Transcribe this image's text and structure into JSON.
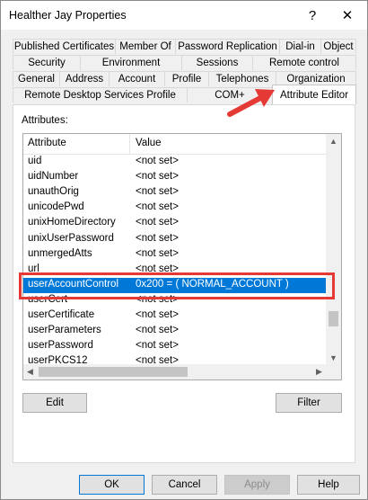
{
  "window": {
    "title": "Healther Jay Properties",
    "help_glyph": "?",
    "close_glyph": "✕"
  },
  "tabs": {
    "row1": [
      "Published Certificates",
      "Member Of",
      "Password Replication",
      "Dial-in",
      "Object"
    ],
    "row2": [
      "Security",
      "Environment",
      "Sessions",
      "Remote control"
    ],
    "row3": [
      "General",
      "Address",
      "Account",
      "Profile",
      "Telephones",
      "Organization"
    ],
    "row4": [
      "Remote Desktop Services Profile",
      "COM+",
      "Attribute Editor"
    ],
    "active": "Attribute Editor"
  },
  "attributes_label": "Attributes:",
  "list": {
    "columns": [
      "Attribute",
      "Value"
    ],
    "rows": [
      {
        "attribute": "uid",
        "value": "<not set>"
      },
      {
        "attribute": "uidNumber",
        "value": "<not set>"
      },
      {
        "attribute": "unauthOrig",
        "value": "<not set>"
      },
      {
        "attribute": "unicodePwd",
        "value": "<not set>"
      },
      {
        "attribute": "unixHomeDirectory",
        "value": "<not set>"
      },
      {
        "attribute": "unixUserPassword",
        "value": "<not set>"
      },
      {
        "attribute": "unmergedAtts",
        "value": "<not set>"
      },
      {
        "attribute": "url",
        "value": "<not set>"
      },
      {
        "attribute": "userAccountControl",
        "value": "0x200 = ( NORMAL_ACCOUNT )"
      },
      {
        "attribute": "userCert",
        "value": "<not set>"
      },
      {
        "attribute": "userCertificate",
        "value": "<not set>"
      },
      {
        "attribute": "userParameters",
        "value": "<not set>"
      },
      {
        "attribute": "userPassword",
        "value": "<not set>"
      },
      {
        "attribute": "userPKCS12",
        "value": "<not set>"
      }
    ],
    "selected_index": 8
  },
  "buttons": {
    "edit": "Edit",
    "filter": "Filter",
    "ok": "OK",
    "cancel": "Cancel",
    "apply": "Apply",
    "help": "Help"
  },
  "colors": {
    "selection": "#0078d7",
    "annotation": "#e53935"
  }
}
